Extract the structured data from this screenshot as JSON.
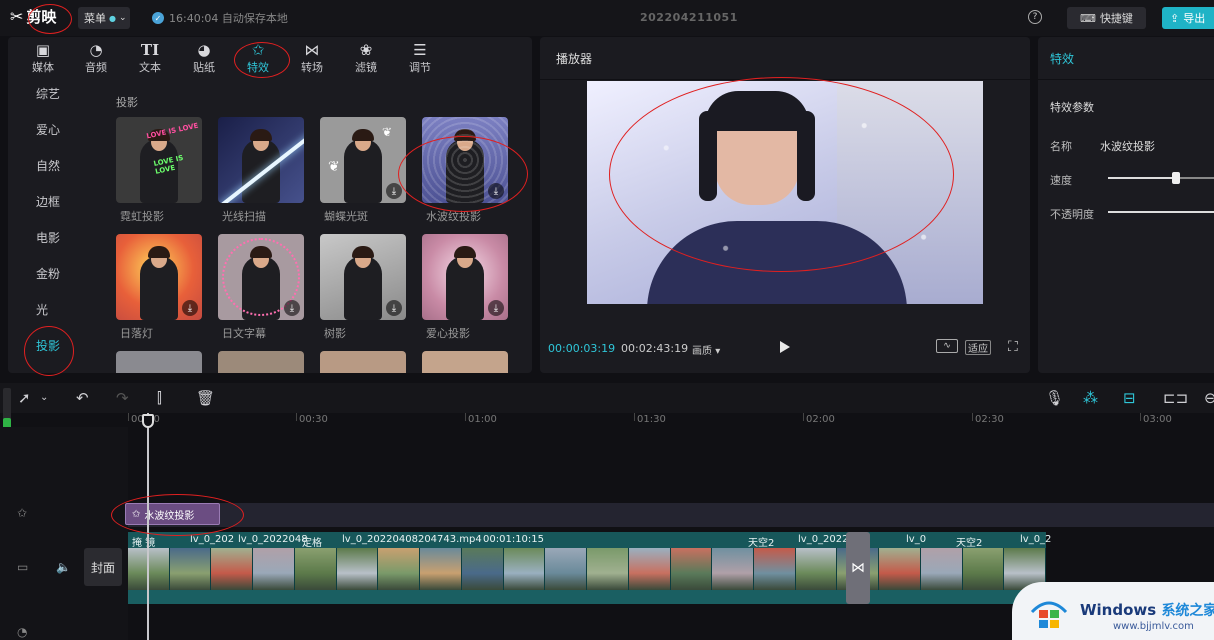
{
  "app": {
    "logo_text": "剪映",
    "menu_label": "菜单",
    "save_status": "16:40:04 自动保存本地",
    "project_title": "202204211051",
    "shortcut_label": "快捷键",
    "export_label": "导出"
  },
  "tabs": [
    {
      "label": "媒体",
      "icon": "media-icon",
      "glyph": "▶"
    },
    {
      "label": "音频",
      "icon": "audio-icon",
      "glyph": "◔"
    },
    {
      "label": "文本",
      "icon": "text-icon",
      "glyph": "TI"
    },
    {
      "label": "贴纸",
      "icon": "sticker-icon",
      "glyph": "◕"
    },
    {
      "label": "特效",
      "icon": "effects-icon",
      "glyph": "✩"
    },
    {
      "label": "转场",
      "icon": "transition-icon",
      "glyph": "⋈"
    },
    {
      "label": "滤镜",
      "icon": "filter-icon",
      "glyph": "❀"
    },
    {
      "label": "调节",
      "icon": "adjust-icon",
      "glyph": "☰"
    }
  ],
  "active_tab": "特效",
  "categories": [
    "综艺",
    "爱心",
    "自然",
    "边框",
    "电影",
    "金粉",
    "光",
    "投影"
  ],
  "active_category": "投影",
  "section_title": "投影",
  "effects": [
    {
      "label": "霓虹投影",
      "bg": "#3a3a3a",
      "overlay": "LOVE IS LOVE"
    },
    {
      "label": "光线扫描",
      "bg": "#2a2f55"
    },
    {
      "label": "蝴蝶光斑",
      "bg": "#9a9a9a"
    },
    {
      "label": "水波纹投影",
      "bg": "#6b6fa8"
    },
    {
      "label": "日落灯",
      "bg": "#e8a040"
    },
    {
      "label": "日文字幕",
      "bg": "#a89aa0"
    },
    {
      "label": "树影",
      "bg": "#b0b0b0"
    },
    {
      "label": "爱心投影",
      "bg": "#d4a6b8"
    }
  ],
  "player": {
    "title": "播放器",
    "current_time": "00:00:03:19",
    "duration": "00:02:43:19",
    "quality": "画质",
    "fit_label": "适应"
  },
  "effect_params": {
    "panel_title": "特效",
    "section": "特效参数",
    "name_label": "名称",
    "name_value": "水波纹投影",
    "speed_label": "速度",
    "speed_value": 0.62,
    "opacity_label": "不透明度",
    "opacity_value": 1.0
  },
  "timeline": {
    "ruler": [
      "00:00",
      "00:30",
      "01:00",
      "01:30",
      "02:00",
      "02:30",
      "03:00"
    ],
    "effect_clip_label": "水波纹投影",
    "cover_label": "封面",
    "clip_labels": [
      "掩 镜",
      "lv_0_202",
      "lv_0_2022048",
      "定格",
      "lv_0_20220408204743.mp4",
      "00:01:10:15",
      "天空2",
      "lv_0_2022",
      "lv_0",
      "天空2",
      "lv_0_2"
    ]
  },
  "watermark": {
    "title": "Windows",
    "title_suffix": "系统之家",
    "url": "www.bjjmlv.com"
  },
  "colors": {
    "accent": "#2fc6d8",
    "clip": "#1d6b6e",
    "effect_clip": "#6b4d82",
    "annotation": "#e02020"
  }
}
